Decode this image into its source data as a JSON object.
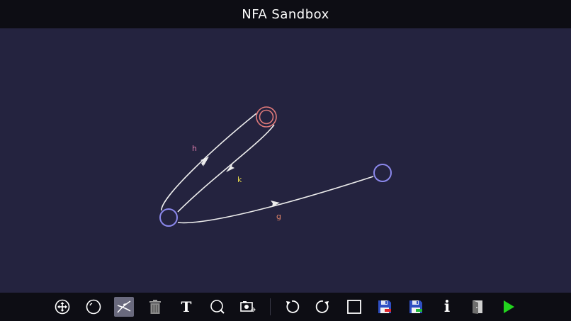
{
  "app": {
    "title": "NFA Sandbox"
  },
  "colors": {
    "background": "#24233f",
    "bar": "#0d0d14",
    "state_normal": "#8b88ec",
    "state_accepting": "#e07a7a",
    "edge": "#ececec",
    "label_h": "#e27fb0",
    "label_k": "#e3d64c",
    "label_g": "#e8876a",
    "tool_active": "#6a6a7e",
    "run_icon": "#22d41e"
  },
  "automaton": {
    "states": [
      {
        "id": "q0",
        "kind": "normal"
      },
      {
        "id": "q1",
        "kind": "accepting"
      },
      {
        "id": "q2",
        "kind": "normal"
      }
    ],
    "transitions": [
      {
        "from": "q0",
        "to": "q1",
        "label": "h"
      },
      {
        "from": "q1",
        "to": "q0",
        "label": "k"
      },
      {
        "from": "q0",
        "to": "q2",
        "label": "g"
      }
    ]
  },
  "toolbar": {
    "tools": [
      {
        "name": "move-tool",
        "icon": "move-icon",
        "active": false
      },
      {
        "name": "add-state-tool",
        "icon": "circle-icon",
        "active": false
      },
      {
        "name": "add-transition-tool",
        "icon": "transition-icon",
        "active": true
      },
      {
        "name": "delete-tool",
        "icon": "trash-icon",
        "active": false
      },
      {
        "name": "text-tool",
        "icon": "text-icon",
        "label": "T",
        "active": false
      },
      {
        "name": "zoom-tool",
        "icon": "zoom-icon",
        "active": false
      },
      {
        "name": "screenshot-tool",
        "icon": "camera-icon",
        "active": false
      },
      {
        "name": "undo-button",
        "icon": "undo-icon",
        "active": false
      },
      {
        "name": "redo-button",
        "icon": "redo-icon",
        "active": false
      },
      {
        "name": "new-button",
        "icon": "blank-page-icon",
        "active": false
      },
      {
        "name": "save-button",
        "icon": "save-icon",
        "active": false
      },
      {
        "name": "load-button",
        "icon": "load-icon",
        "active": false
      },
      {
        "name": "info-button",
        "icon": "info-icon",
        "label": "i",
        "active": false
      },
      {
        "name": "exit-button",
        "icon": "door-icon",
        "active": false
      },
      {
        "name": "run-button",
        "icon": "play-icon",
        "active": false
      }
    ]
  }
}
